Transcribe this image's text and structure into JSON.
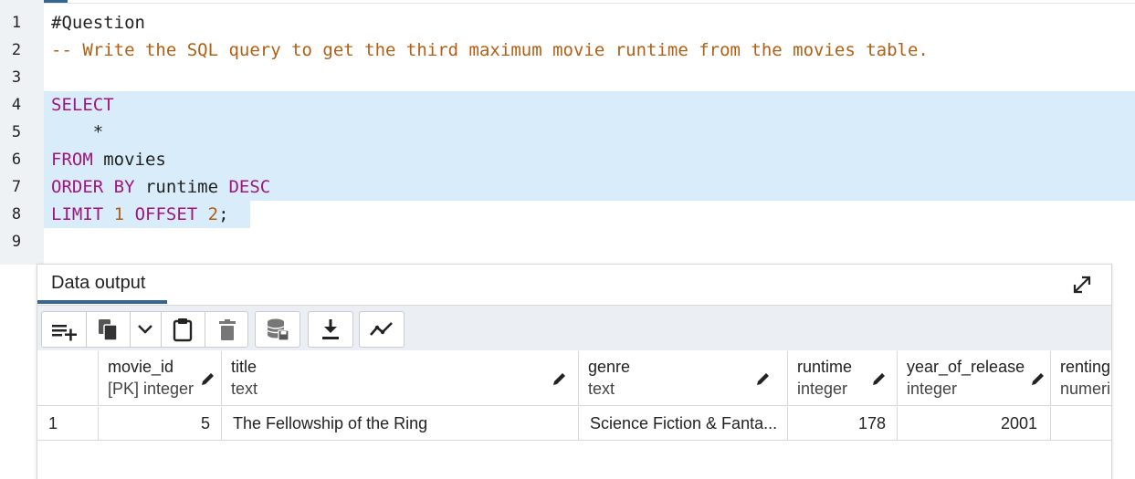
{
  "editor": {
    "lines": [
      {
        "n": "1",
        "parts": [
          {
            "t": "#Question",
            "c": "txt"
          }
        ]
      },
      {
        "n": "2",
        "parts": [
          {
            "t": "-- Write the SQL query to get the third maximum movie runtime from the movies table.",
            "c": "cm"
          }
        ]
      },
      {
        "n": "3",
        "parts": []
      },
      {
        "n": "4",
        "parts": [
          {
            "t": "SELECT",
            "c": "kw"
          }
        ]
      },
      {
        "n": "5",
        "parts": [
          {
            "t": "    *",
            "c": "txt"
          }
        ]
      },
      {
        "n": "6",
        "parts": [
          {
            "t": "FROM",
            "c": "kw"
          },
          {
            "t": " movies",
            "c": "txt"
          }
        ]
      },
      {
        "n": "7",
        "parts": [
          {
            "t": "ORDER BY",
            "c": "kw"
          },
          {
            "t": " runtime ",
            "c": "txt"
          },
          {
            "t": "DESC",
            "c": "kw"
          }
        ]
      },
      {
        "n": "8",
        "parts": [
          {
            "t": "LIMIT",
            "c": "kw"
          },
          {
            "t": " ",
            "c": "txt"
          },
          {
            "t": "1",
            "c": "num"
          },
          {
            "t": " ",
            "c": "txt"
          },
          {
            "t": "OFFSET",
            "c": "kw"
          },
          {
            "t": " ",
            "c": "txt"
          },
          {
            "t": "2",
            "c": "num"
          },
          {
            "t": ";",
            "c": "txt"
          }
        ]
      },
      {
        "n": "9",
        "parts": []
      }
    ]
  },
  "output_panel": {
    "tab_label": "Data output",
    "toolbar_icons": [
      "add-row-icon",
      "copy-icon",
      "chevron-down-icon",
      "paste-icon",
      "delete-icon",
      "save-data-icon",
      "download-icon",
      "graph-icon"
    ],
    "columns": [
      {
        "name": "movie_id",
        "type": "[PK] integer"
      },
      {
        "name": "title",
        "type": "text"
      },
      {
        "name": "genre",
        "type": "text"
      },
      {
        "name": "runtime",
        "type": "integer"
      },
      {
        "name": "year_of_release",
        "type": "integer"
      },
      {
        "name": "renting",
        "type": "numeri"
      }
    ],
    "rows": [
      {
        "row_number": "1",
        "cells": [
          "5",
          "The Fellowship of the Ring",
          "Science Fiction & Fanta...",
          "178",
          "2001",
          ""
        ]
      }
    ]
  },
  "colors": {
    "keyword": "#a0157f",
    "comment": "#b05f13",
    "selection": "#d8ecfa",
    "accent": "#326690"
  }
}
